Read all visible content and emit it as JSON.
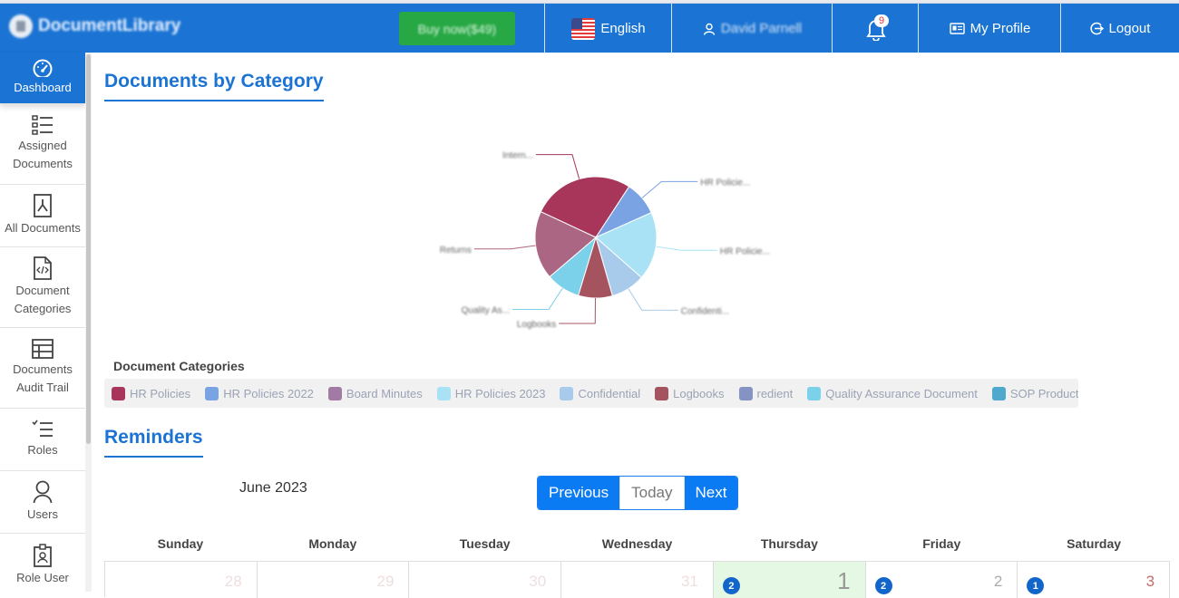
{
  "header": {
    "brand": "DocumentLibrary",
    "buy_label": "Buy now($49)",
    "language": "English",
    "user_name": "David Parnell",
    "notification_count": "9",
    "profile_label": "My Profile",
    "logout_label": "Logout"
  },
  "sidebar": {
    "items": [
      {
        "label": "Dashboard",
        "icon": "dashboard-icon",
        "active": true
      },
      {
        "label": "Assigned Documents",
        "icon": "list-icon"
      },
      {
        "label": "All Documents",
        "icon": "pdf-icon"
      },
      {
        "label": "Document Categories",
        "icon": "code-file-icon"
      },
      {
        "label": "Documents Audit Trail",
        "icon": "table-icon"
      },
      {
        "label": "Roles",
        "icon": "checklist-icon"
      },
      {
        "label": "Users",
        "icon": "user-icon"
      },
      {
        "label": "Role User",
        "icon": "badge-icon"
      }
    ]
  },
  "main": {
    "chart_section_title": "Documents by Category",
    "legend_title": "Document Categories",
    "reminders_title": "Reminders",
    "calendar": {
      "month_label": "June 2023",
      "prev_label": "Previous",
      "today_label": "Today",
      "next_label": "Next",
      "weekdays": [
        "Sunday",
        "Monday",
        "Tuesday",
        "Wednesday",
        "Thursday",
        "Friday",
        "Saturday"
      ],
      "first_row": [
        {
          "day": "28",
          "other_month": true,
          "count": null
        },
        {
          "day": "29",
          "other_month": true,
          "count": null
        },
        {
          "day": "30",
          "other_month": true,
          "count": null
        },
        {
          "day": "31",
          "other_month": true,
          "count": null
        },
        {
          "day": "1",
          "today": true,
          "count": "2"
        },
        {
          "day": "2",
          "count": "2"
        },
        {
          "day": "3",
          "count": "1"
        }
      ]
    }
  },
  "chart_data": {
    "type": "pie",
    "title": "Documents by Category",
    "legend_title": "Document Categories",
    "legend_position": "bottom",
    "legend": [
      {
        "name": "HR Policies",
        "color": "#a8365a"
      },
      {
        "name": "HR Policies 2022",
        "color": "#7aa3e3"
      },
      {
        "name": "Board Minutes",
        "color": "#a27ba4"
      },
      {
        "name": "HR Policies 2023",
        "color": "#a9e2f4"
      },
      {
        "name": "Confidential",
        "color": "#a9cbeb"
      },
      {
        "name": "Logbooks",
        "color": "#a5545f"
      },
      {
        "name": "redient",
        "color": "#8493c2"
      },
      {
        "name": "Quality Assurance Document",
        "color": "#7cd1ea"
      },
      {
        "name": "SOP Production",
        "color": "#4ea9cc"
      },
      {
        "name": "",
        "color": "#ab6683"
      }
    ],
    "slices": [
      {
        "label": "Intern...",
        "value": 3,
        "color": "#a8365a"
      },
      {
        "label": "HR Policie...",
        "value": 1,
        "color": "#7aa3e3"
      },
      {
        "label": "HR Policie...",
        "value": 2,
        "color": "#a9e2f4"
      },
      {
        "label": "Confidenti...",
        "value": 1,
        "color": "#a9cbeb"
      },
      {
        "label": "Logbooks",
        "value": 1,
        "color": "#a5545f"
      },
      {
        "label": "Quality As...",
        "value": 1,
        "color": "#7cd1ea"
      },
      {
        "label": "Returns",
        "value": 2,
        "color": "#ab6683"
      }
    ]
  }
}
